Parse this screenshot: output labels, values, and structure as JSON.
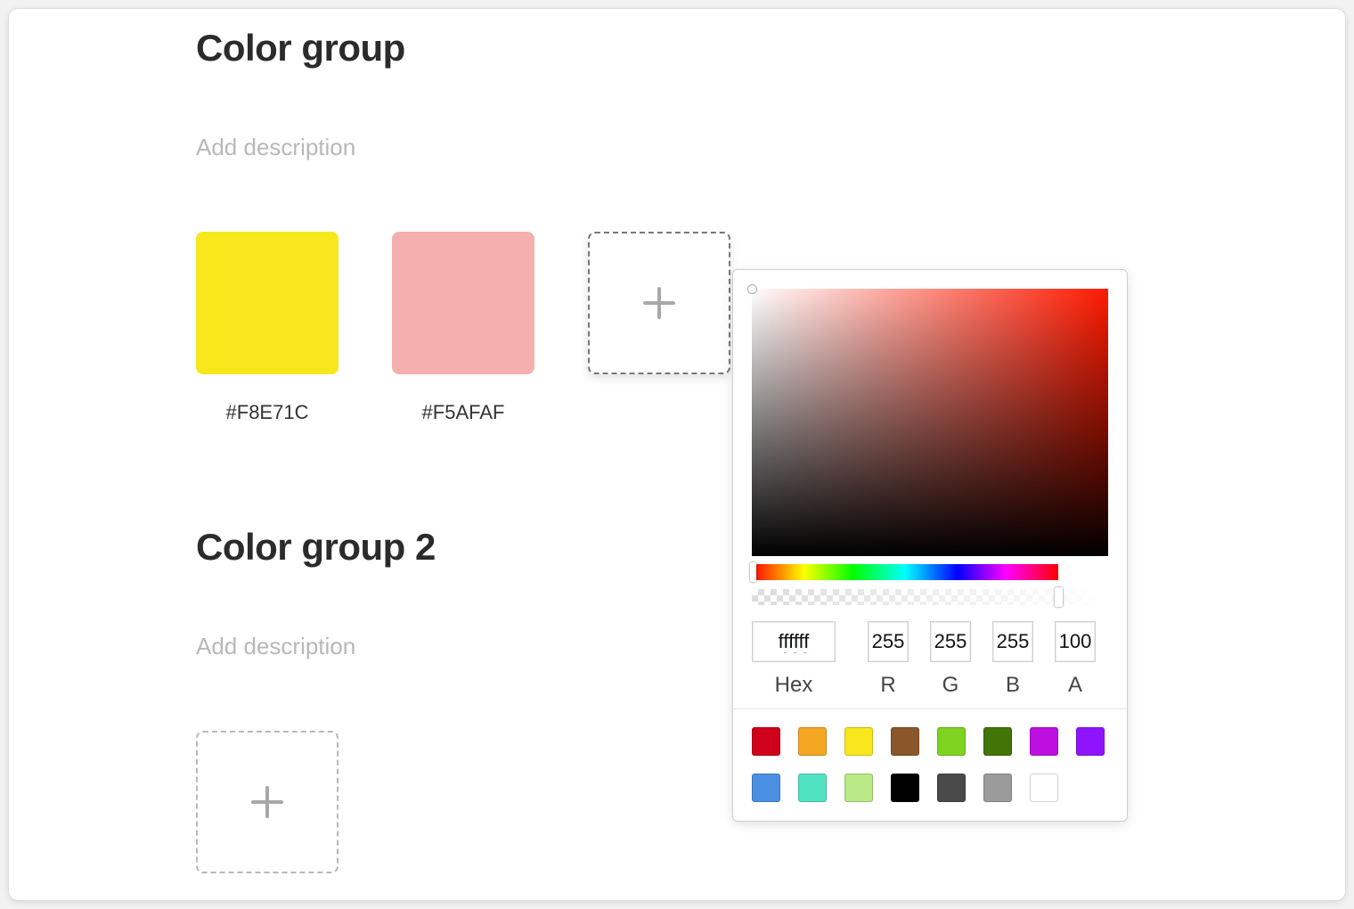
{
  "groups": [
    {
      "title": "Color group",
      "description_placeholder": "Add description",
      "swatches": [
        {
          "hex": "#F8E71C",
          "label": "#F8E71C"
        },
        {
          "hex": "#F5AFAF",
          "label": "#F5AFAF"
        }
      ]
    },
    {
      "title": "Color group 2",
      "description_placeholder": "Add description",
      "swatches": []
    }
  ],
  "picker": {
    "hue_color": "#ff1a00",
    "hex_value": "ffffff",
    "r_value": "255",
    "g_value": "255",
    "b_value": "255",
    "a_value": "100",
    "labels": {
      "hex": "Hex",
      "r": "R",
      "g": "G",
      "b": "B",
      "a": "A"
    },
    "presets": [
      "#D0021B",
      "#F5A623",
      "#F8E71C",
      "#8B572A",
      "#7ED321",
      "#417505",
      "#BD10E0",
      "#9013FE",
      "#4A90E2",
      "#50E3C2",
      "#B8E986",
      "#000000",
      "#4A4A4A",
      "#9B9B9B",
      "#FFFFFF"
    ]
  }
}
